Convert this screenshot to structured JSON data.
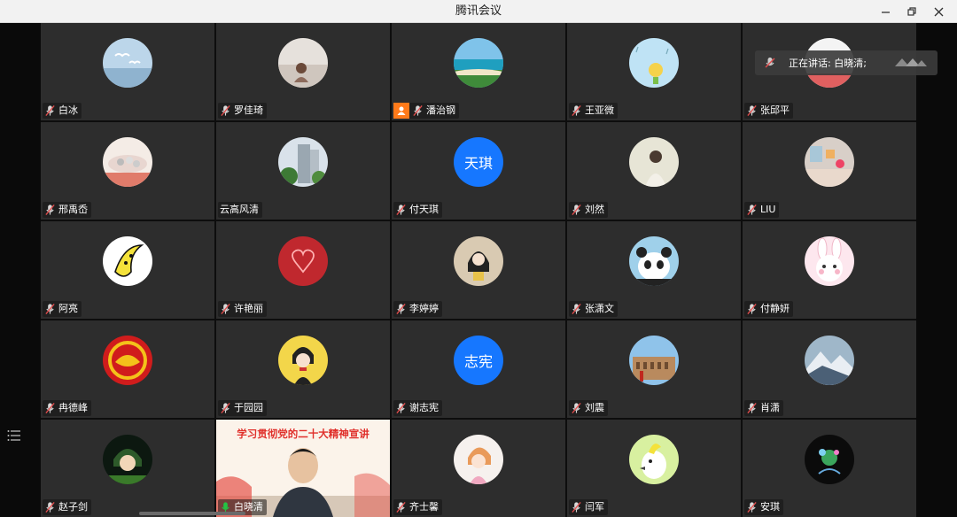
{
  "window": {
    "title": "腾讯会议",
    "controls": [
      "minimize-icon",
      "restore-icon",
      "close-icon"
    ]
  },
  "speaking": {
    "label": "正在讲话: 白晓清;",
    "icon": "mic-icon"
  },
  "sidebar": {
    "menu_icon": "list-icon"
  },
  "banner_text": "学习贯彻党的二十大精神宣讲",
  "participants": [
    {
      "name": "白冰",
      "avatar": "seagull-sky"
    },
    {
      "name": "罗佳琦",
      "avatar": "girl-photo"
    },
    {
      "name": "潘治钢",
      "avatar": "beach",
      "host_badge": true
    },
    {
      "name": "王亚微",
      "avatar": "cartoon-rain"
    },
    {
      "name": "张邱平",
      "avatar": "covered"
    },
    {
      "name": "邢禹岙",
      "avatar": "plate-food"
    },
    {
      "name": "云高风清",
      "avatar": "building",
      "no_mic": true
    },
    {
      "name": "付天琪",
      "avatar_text": "天琪"
    },
    {
      "name": "刘然",
      "avatar": "figure-back"
    },
    {
      "name": "LIU",
      "avatar": "room-decor"
    },
    {
      "name": "阿亮",
      "avatar": "banana"
    },
    {
      "name": "许艳丽",
      "avatar": "hearts-red"
    },
    {
      "name": "李婷婷",
      "avatar": "girl-illustration"
    },
    {
      "name": "张潇文",
      "avatar": "panda"
    },
    {
      "name": "付静妍",
      "avatar": "bunny"
    },
    {
      "name": "冉德峰",
      "avatar": "dragon-emblem"
    },
    {
      "name": "于园园",
      "avatar": "lady-cartoon"
    },
    {
      "name": "谢志宪",
      "avatar_text": "志宪"
    },
    {
      "name": "刘震",
      "avatar": "colosseum"
    },
    {
      "name": "肖潇",
      "avatar": "snow-mountain"
    },
    {
      "name": "赵子剑",
      "avatar": "anime-boy"
    },
    {
      "name": "白晓清",
      "video": true,
      "speaking": true
    },
    {
      "name": "齐士馨",
      "avatar": "baby-girl"
    },
    {
      "name": "闫军",
      "avatar": "cockatoo"
    },
    {
      "name": "安琪",
      "avatar": "space-flower"
    }
  ],
  "colors": {
    "tile_bg": "#2d2d2d",
    "accent_blue": "#1677ff",
    "host_orange": "#ff7a1a",
    "mic_green": "#23c343",
    "mic_muted": "#e34d4d"
  }
}
